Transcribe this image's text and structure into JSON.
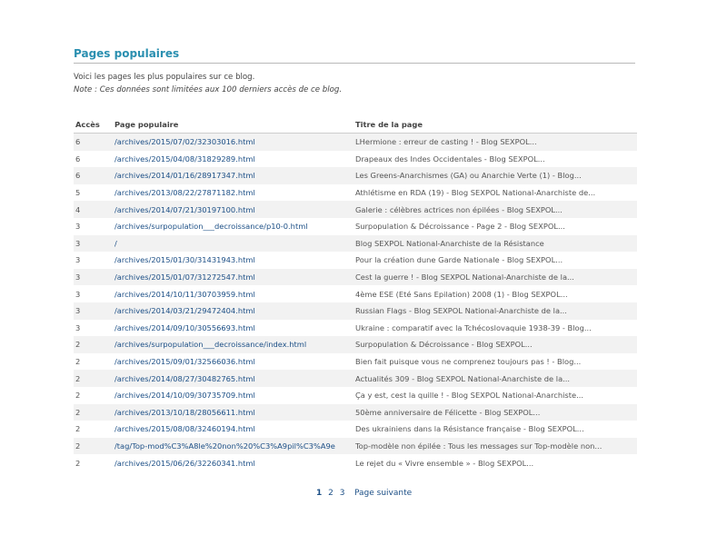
{
  "heading": "Pages populaires",
  "intro": {
    "line1": "Voici les pages les plus populaires sur ce blog.",
    "note": "Note : Ces données sont limitées aux 100 derniers accès de ce blog."
  },
  "table": {
    "columns": [
      "Accès",
      "Page populaire",
      "Titre de la page"
    ],
    "rows": [
      {
        "count": "6",
        "page": "/archives/2015/07/02/32303016.html",
        "title": "LHermione : erreur de casting ! - Blog SEXPOL..."
      },
      {
        "count": "6",
        "page": "/archives/2015/04/08/31829289.html",
        "title": "Drapeaux des Indes Occidentales - Blog SEXPOL..."
      },
      {
        "count": "6",
        "page": "/archives/2014/01/16/28917347.html",
        "title": "Les Greens-Anarchismes (GA) ou Anarchie Verte (1) - Blog..."
      },
      {
        "count": "5",
        "page": "/archives/2013/08/22/27871182.html",
        "title": "Athlétisme en RDA (19) - Blog SEXPOL National-Anarchiste de..."
      },
      {
        "count": "4",
        "page": "/archives/2014/07/21/30197100.html",
        "title": "Galerie : célèbres actrices non épilées - Blog SEXPOL..."
      },
      {
        "count": "3",
        "page": "/archives/surpopulation___decroissance/p10-0.html",
        "title": "Surpopulation & Décroissance - Page 2 - Blog SEXPOL..."
      },
      {
        "count": "3",
        "page": "/",
        "title": "Blog SEXPOL National-Anarchiste de la Résistance"
      },
      {
        "count": "3",
        "page": "/archives/2015/01/30/31431943.html",
        "title": "Pour la création dune Garde Nationale - Blog SEXPOL..."
      },
      {
        "count": "3",
        "page": "/archives/2015/01/07/31272547.html",
        "title": "Cest la guerre ! - Blog SEXPOL National-Anarchiste de la..."
      },
      {
        "count": "3",
        "page": "/archives/2014/10/11/30703959.html",
        "title": "4ème ESE (Eté Sans Epilation) 2008 (1) - Blog SEXPOL..."
      },
      {
        "count": "3",
        "page": "/archives/2014/03/21/29472404.html",
        "title": "Russian Flags - Blog SEXPOL National-Anarchiste de la..."
      },
      {
        "count": "3",
        "page": "/archives/2014/09/10/30556693.html",
        "title": "Ukraine : comparatif avec la Tchécoslovaquie 1938-39 - Blog..."
      },
      {
        "count": "2",
        "page": "/archives/surpopulation___decroissance/index.html",
        "title": "Surpopulation & Décroissance - Blog SEXPOL..."
      },
      {
        "count": "2",
        "page": "/archives/2015/09/01/32566036.html",
        "title": "Bien fait puisque vous ne comprenez toujours pas ! - Blog..."
      },
      {
        "count": "2",
        "page": "/archives/2014/08/27/30482765.html",
        "title": "Actualités 309 - Blog SEXPOL National-Anarchiste de la..."
      },
      {
        "count": "2",
        "page": "/archives/2014/10/09/30735709.html",
        "title": "Ça y est, cest la quille ! - Blog SEXPOL National-Anarchiste..."
      },
      {
        "count": "2",
        "page": "/archives/2013/10/18/28056611.html",
        "title": "50ème anniversaire de Félicette - Blog SEXPOL..."
      },
      {
        "count": "2",
        "page": "/archives/2015/08/08/32460194.html",
        "title": "Des ukrainiens dans la Résistance française - Blog SEXPOL..."
      },
      {
        "count": "2",
        "page": "/tag/Top-mod%C3%A8le%20non%20%C3%A9pil%C3%A9e",
        "title": "Top-modèle non épilée : Tous les messages sur Top-modèle non..."
      },
      {
        "count": "2",
        "page": "/archives/2015/06/26/32260341.html",
        "title": "Le rejet du « Vivre ensemble » - Blog SEXPOL..."
      }
    ]
  },
  "pagination": {
    "current": "1",
    "pages": [
      "2",
      "3"
    ],
    "next_label": "Page suivante"
  },
  "colors": {
    "heading": "#2a8fb0",
    "link": "#1c4f86",
    "row_alt": "#f2f2f2"
  }
}
